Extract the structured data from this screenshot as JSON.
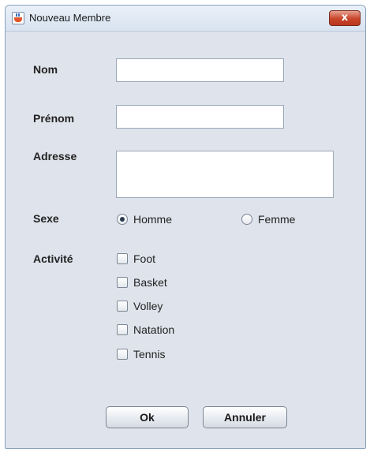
{
  "window": {
    "title": "Nouveau Membre",
    "close_symbol": "x"
  },
  "form": {
    "nom": {
      "label": "Nom",
      "value": ""
    },
    "prenom": {
      "label": "Prénom",
      "value": ""
    },
    "adresse": {
      "label": "Adresse",
      "value": ""
    },
    "sexe": {
      "label": "Sexe",
      "options": [
        {
          "label": "Homme",
          "checked": true
        },
        {
          "label": "Femme",
          "checked": false
        }
      ]
    },
    "activite": {
      "label": "Activité",
      "options": [
        {
          "label": "Foot",
          "checked": false
        },
        {
          "label": "Basket",
          "checked": false
        },
        {
          "label": "Volley",
          "checked": false
        },
        {
          "label": "Natation",
          "checked": false
        },
        {
          "label": "Tennis",
          "checked": false
        }
      ]
    }
  },
  "buttons": {
    "ok": "Ok",
    "cancel": "Annuler"
  },
  "icons": {
    "app": "java-app-icon",
    "close": "close-icon"
  },
  "colors": {
    "window_bg": "#dfe3eb",
    "close_button": "#c8442a"
  }
}
